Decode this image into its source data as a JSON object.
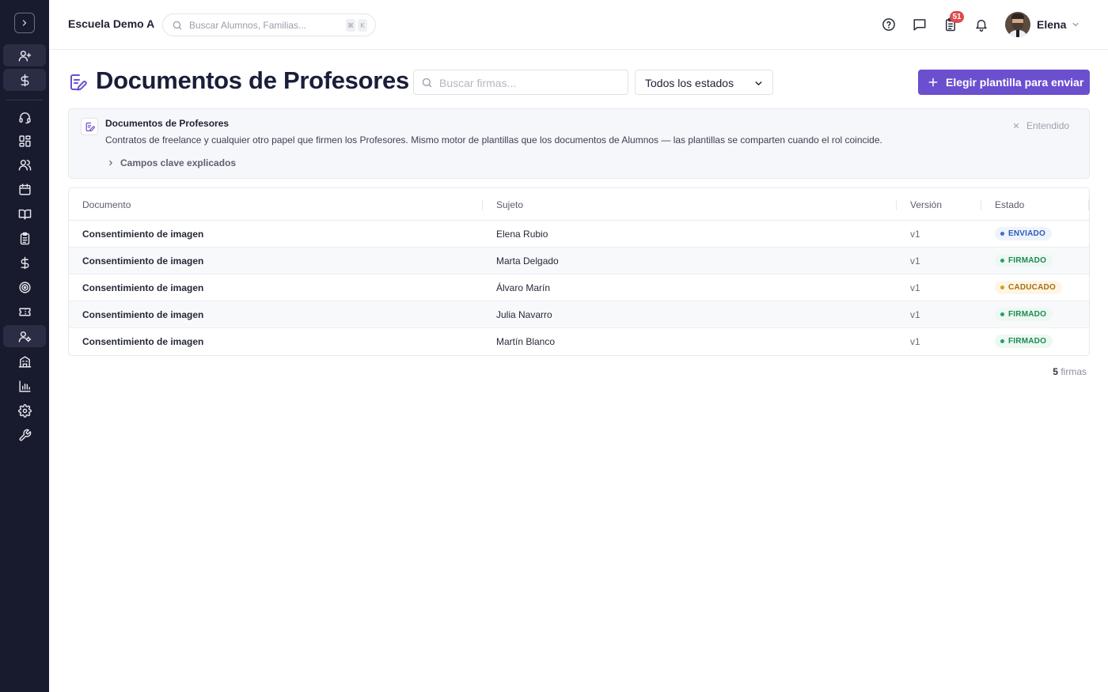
{
  "app": {
    "school_name": "Escuela Demo A",
    "search_placeholder": "Buscar Alumnos, Familias...",
    "shortcut_keys": [
      "⌘",
      "K"
    ],
    "notification_count": "51",
    "user_name": "Elena"
  },
  "sidebar": {
    "items": [
      {
        "icon": "user-plus-icon"
      },
      {
        "icon": "dollar-icon"
      },
      {
        "icon": "headset-icon"
      },
      {
        "icon": "dashboard-grid-icon"
      },
      {
        "icon": "users-icon"
      },
      {
        "icon": "calendar-icon"
      },
      {
        "icon": "book-icon"
      },
      {
        "icon": "clipboard-icon"
      },
      {
        "icon": "dollar-icon"
      },
      {
        "icon": "target-icon"
      },
      {
        "icon": "ticket-icon"
      },
      {
        "icon": "user-settings-icon",
        "active": true
      },
      {
        "icon": "building-icon"
      },
      {
        "icon": "bar-chart-icon"
      },
      {
        "icon": "gear-icon"
      },
      {
        "icon": "wrench-icon"
      }
    ]
  },
  "page": {
    "title": "Documentos de Profesores",
    "search_placeholder": "Buscar firmas...",
    "status_filter": "Todos los estados",
    "primary_action": "Elegir plantilla para enviar"
  },
  "banner": {
    "title": "Documentos de Profesores",
    "text": "Contratos de freelance y cualquier otro papel que firmen los Profesores. Mismo motor de plantillas que los documentos de Alumnos — las plantillas se comparten cuando el rol coincide.",
    "dismiss": "Entendido",
    "expander": "Campos clave explicados"
  },
  "table": {
    "columns": [
      "Documento",
      "Sujeto",
      "Versión",
      "Estado"
    ],
    "rows": [
      {
        "document": "Consentimiento de imagen",
        "subject": "Elena Rubio",
        "version": "v1",
        "status": "ENVIADO"
      },
      {
        "document": "Consentimiento de imagen",
        "subject": "Marta Delgado",
        "version": "v1",
        "status": "FIRMADO"
      },
      {
        "document": "Consentimiento de imagen",
        "subject": "Álvaro Marín",
        "version": "v1",
        "status": "CADUCADO"
      },
      {
        "document": "Consentimiento de imagen",
        "subject": "Julia Navarro",
        "version": "v1",
        "status": "FIRMADO"
      },
      {
        "document": "Consentimiento de imagen",
        "subject": "Martín Blanco",
        "version": "v1",
        "status": "FIRMADO"
      }
    ]
  },
  "footer": {
    "count": "5",
    "count_label": "firmas"
  },
  "colors": {
    "sidebar_bg": "#181a2e",
    "accent": "#6b4fcf",
    "status_enviado": "#3b6fd6",
    "status_firmado": "#22a366",
    "status_caducado": "#d99a17"
  }
}
